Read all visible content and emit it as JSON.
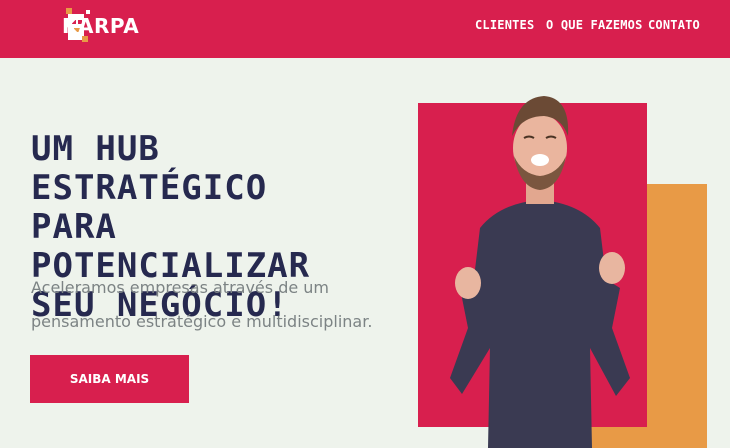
{
  "brand": {
    "name": "KARPA"
  },
  "nav": {
    "items": [
      {
        "label": "CLIENTES"
      },
      {
        "label": "O QUE FAZEMOS"
      },
      {
        "label": "CONTATO"
      }
    ]
  },
  "hero": {
    "headline_lines": [
      "UM HUB ESTRATÉGICO",
      "PARA POTENCIALIZAR",
      "SEU NEGÓCIO!"
    ],
    "subtext_lines": [
      "Aceleramos empresas através de um",
      "pensamento estratégico e multidisciplinar."
    ],
    "cta_label": "SAIBA MAIS"
  },
  "colors": {
    "brand_red": "#d81f4e",
    "accent_orange": "#e89a46",
    "headline_navy": "#26294f",
    "background": "#eef3ec"
  }
}
